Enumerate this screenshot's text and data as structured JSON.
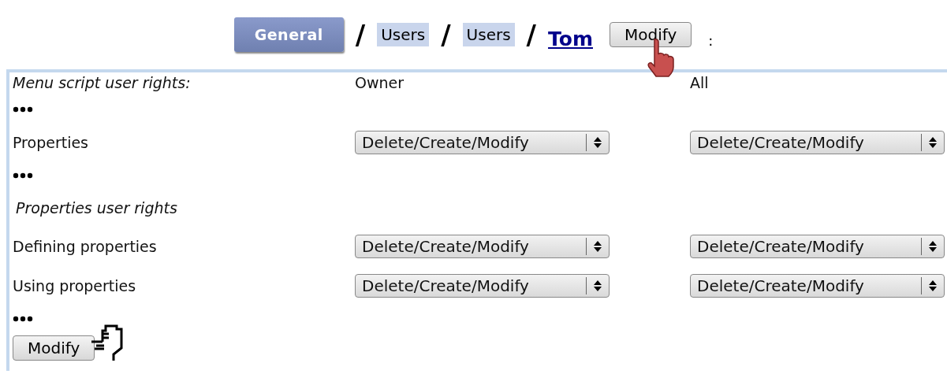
{
  "breadcrumb": {
    "items": [
      {
        "kind": "tab",
        "label": "General"
      },
      {
        "kind": "separator",
        "label": "/"
      },
      {
        "kind": "chip",
        "label": "Users"
      },
      {
        "kind": "separator",
        "label": "/"
      },
      {
        "kind": "chip",
        "label": "Users"
      },
      {
        "kind": "separator",
        "label": "/"
      },
      {
        "kind": "link",
        "label": "Tom"
      }
    ],
    "button": "Modify",
    "trailing": ":"
  },
  "panel": {
    "heading": "Menu script user rights:",
    "columns": [
      "Owner",
      "All"
    ],
    "rows": [
      {
        "kind": "ellipsis"
      },
      {
        "kind": "setting",
        "label": "Properties",
        "values": [
          "Delete/Create/Modify",
          "Delete/Create/Modify"
        ]
      },
      {
        "kind": "ellipsis"
      },
      {
        "kind": "section",
        "label": "Properties user rights"
      },
      {
        "kind": "setting",
        "label": "Defining properties",
        "values": [
          "Delete/Create/Modify",
          "Delete/Create/Modify"
        ]
      },
      {
        "kind": "setting",
        "label": "Using properties",
        "values": [
          "Delete/Create/Modify",
          "Delete/Create/Modify"
        ]
      },
      {
        "kind": "ellipsis"
      }
    ],
    "submit": "Modify"
  }
}
